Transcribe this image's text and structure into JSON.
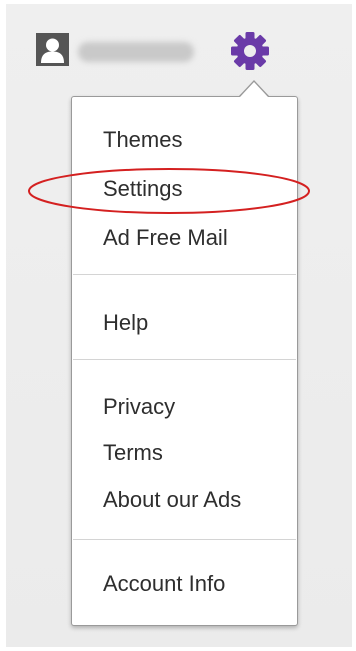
{
  "header": {
    "avatar_icon": "user-silhouette-icon",
    "settings_icon": "gear-icon",
    "gear_color": "#6a3aa8"
  },
  "menu": {
    "group_1": [
      "Themes",
      "Settings",
      "Ad Free Mail"
    ],
    "group_2": [
      "Help"
    ],
    "group_3": [
      "Privacy",
      "Terms",
      "About our Ads"
    ],
    "group_4": [
      "Account Info"
    ]
  },
  "annotation": {
    "type": "ellipse",
    "color": "#d42020",
    "target": "Settings"
  }
}
